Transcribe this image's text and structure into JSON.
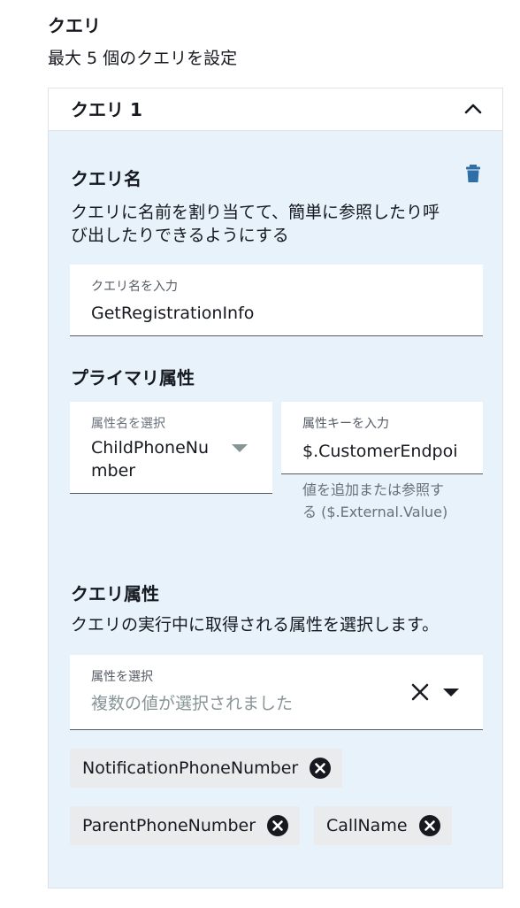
{
  "section": {
    "title": "クエリ",
    "description": "最大 5 個のクエリを設定"
  },
  "query": {
    "header_title": "クエリ 1",
    "header_icon": "chevron-up-icon",
    "name_section": {
      "label": "クエリ名",
      "description_line1": "クエリに名前を割り当てて、簡単に参照したり呼",
      "description_line2": "び出したりできるようにする",
      "delete_icon": "trash-icon",
      "input_label": "クエリ名を入力",
      "input_value": "GetRegistrationInfo"
    },
    "primary_attribute": {
      "label": "プライマリ属性",
      "select_label": "属性名を選択",
      "select_value_line1": "ChildPhoneNu",
      "select_value_line2": "mber",
      "key_label": "属性キーを入力",
      "key_value": "$.CustomerEndpoi",
      "key_hint_line1": "値を追加または参照す",
      "key_hint_line2": "る ($.External.Value)"
    },
    "query_attributes": {
      "label": "クエリ属性",
      "description": "クエリの実行中に取得される属性を選択します。",
      "select_label": "属性を選択",
      "select_placeholder": "複数の値が選択されました",
      "tokens": [
        "NotificationPhoneNumber",
        "ParentPhoneNumber",
        "CallName"
      ]
    }
  },
  "colors": {
    "panel_bg": "#e8f2fb",
    "accent_icon": "#2f6fa7",
    "token_bg": "#e9ebed"
  }
}
